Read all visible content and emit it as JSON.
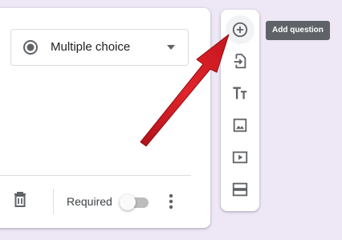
{
  "question": {
    "type_select": {
      "selected_value": "Multiple choice",
      "selected_icon": "radio-button-checked-icon",
      "dropdown_icon": "arrow-drop-down-icon"
    },
    "footer": {
      "delete_icon": "trash-icon",
      "required_label": "Required",
      "required_on": false,
      "more_icon": "more-vert-icon"
    }
  },
  "toolbar": {
    "items": [
      {
        "name": "add-question",
        "icon": "add-circle-icon"
      },
      {
        "name": "import-questions",
        "icon": "import-icon"
      },
      {
        "name": "add-title-description",
        "icon": "title-text-icon"
      },
      {
        "name": "add-image",
        "icon": "image-icon"
      },
      {
        "name": "add-video",
        "icon": "video-icon"
      },
      {
        "name": "add-section",
        "icon": "section-icon"
      }
    ],
    "tooltip": "Add question"
  },
  "annotation": {
    "arrow_color": "#d81f26"
  },
  "colors": {
    "page_background": "#ede7f6",
    "card_background": "#ffffff",
    "icon": "#5f6368",
    "tooltip_background": "#5f6368"
  }
}
